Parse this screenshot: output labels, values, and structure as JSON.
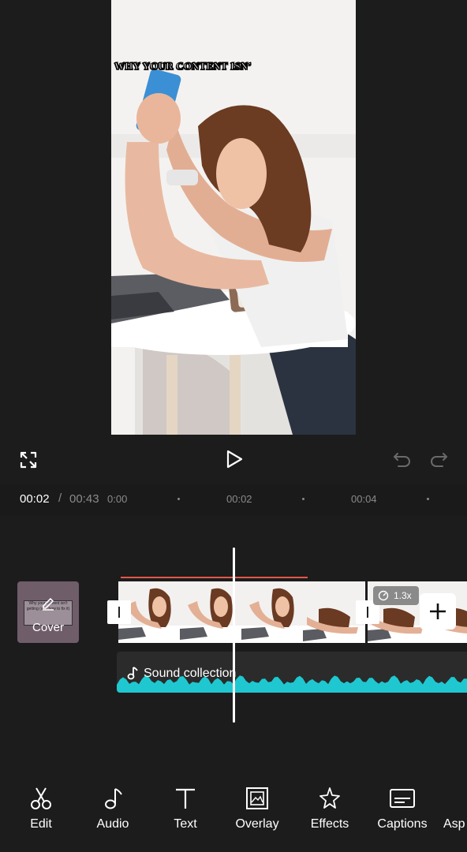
{
  "preview": {
    "overlay_text": "Why your content isn’"
  },
  "controls": {
    "fullscreen_icon": "fullscreen-icon",
    "play_icon": "play-icon",
    "undo_icon": "undo-icon",
    "redo_icon": "redo-icon"
  },
  "time": {
    "current": "00:02",
    "separator": "/",
    "total": "00:43",
    "ticks": [
      "0:00",
      "00:02",
      "00:04"
    ]
  },
  "timeline": {
    "cover_label": "Cover",
    "cover_card_text": "Why your content isn't getting (and how to fix it)",
    "speed_badge": "1.3x",
    "audio_label": "Sound collection",
    "waveform_color": "#1fc8d0",
    "selection_color": "#e4574a"
  },
  "toolbar": {
    "items": [
      {
        "label": "Edit",
        "icon": "scissors-icon"
      },
      {
        "label": "Audio",
        "icon": "music-note-icon"
      },
      {
        "label": "Text",
        "icon": "text-icon"
      },
      {
        "label": "Overlay",
        "icon": "overlay-icon"
      },
      {
        "label": "Effects",
        "icon": "star-icon"
      },
      {
        "label": "Captions",
        "icon": "captions-icon"
      },
      {
        "label": "Asp"
      }
    ]
  }
}
